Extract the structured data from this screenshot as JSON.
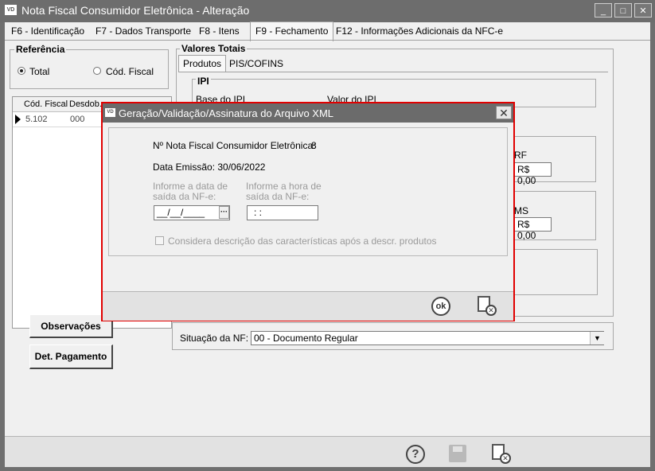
{
  "window": {
    "app_icon": "VD",
    "title": "Nota Fiscal Consumidor Eletrônica - Alteração",
    "minimize": "_",
    "maximize": "□",
    "close": "✕"
  },
  "tabs": [
    {
      "label": "F6 - Identificação"
    },
    {
      "label": "F7 - Dados Transporte"
    },
    {
      "label": "F8 - Itens"
    },
    {
      "label": "F9 - Fechamento",
      "selected": true
    },
    {
      "label": "F12 - Informações Adicionais da NFC-e"
    }
  ],
  "referencia": {
    "title": "Referência",
    "options": [
      "Total",
      "Cód. Fiscal"
    ],
    "selected": "Total"
  },
  "grid": {
    "columns": [
      "Cód. Fiscal",
      "Desdob."
    ],
    "rows": [
      [
        "5.102",
        "000"
      ]
    ]
  },
  "valores_totais": {
    "title": "Valores Totais",
    "subtabs": [
      "Produtos",
      "PIS/COFINS"
    ],
    "ipi_title": "IPI",
    "ipi_base_label": "Base do IPI",
    "ipi_valor_label": "Valor do IPI",
    "partial_label_1": "RF",
    "value_1": "R$ 0,00",
    "partial_label_2": "MS",
    "value_2": "R$ 0,00"
  },
  "buttons": {
    "observacoes": "Observações",
    "det_pagamento": "Det. Pagamento"
  },
  "situacao": {
    "label": "Situação da NF:",
    "value": "00 - Documento Regular"
  },
  "modal": {
    "app_icon": "VD",
    "title": "Geração/Validação/Assinatura do Arquivo XML",
    "close": "✕",
    "nfce_label": "Nº Nota Fiscal Consumidor Eletrônica:",
    "nfce_value": "8",
    "data_emissao": "Data Emissão: 30/06/2022",
    "date_label_1": "Informe a data de",
    "date_label_2": "saída da NF-e:",
    "date_value": "__/__/____",
    "date_button": "···",
    "time_label_1": "Informe a hora de",
    "time_label_2": "saída da NF-e:",
    "time_value": ": :",
    "checkbox_label": "Considera descrição das características após a descr. produtos",
    "ok_label": "ok"
  }
}
